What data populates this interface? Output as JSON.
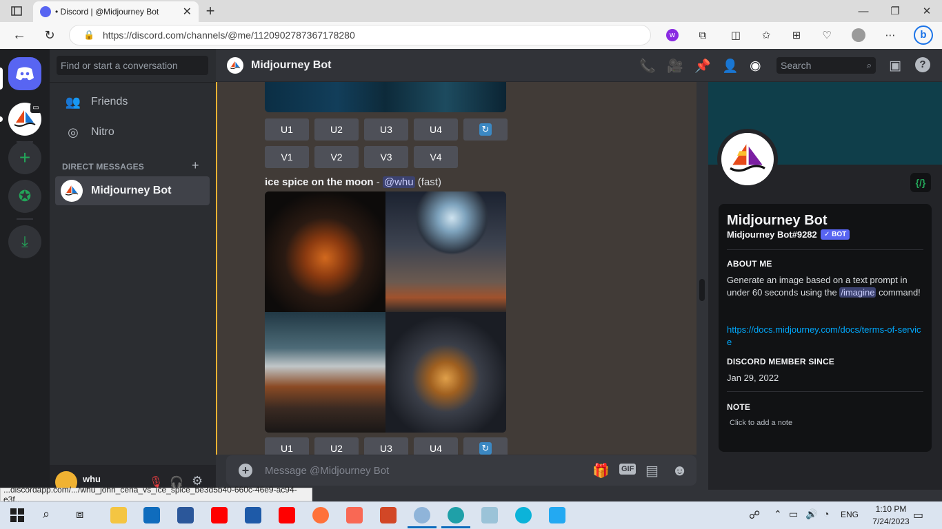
{
  "browser": {
    "tab_title": "• Discord | @Midjourney Bot",
    "url": "https://discord.com/channels/@me/1120902787367178280",
    "status_link": "...discordapp.com/.../whu_john_cena_vs_ice_spice_be3d5b40-660c-46e9-ac94-e3f..."
  },
  "sidebar": {
    "search_placeholder": "Find or start a conversation",
    "friends": "Friends",
    "nitro": "Nitro",
    "dm_header": "DIRECT MESSAGES",
    "dm_item": "Midjourney Bot",
    "user_name": "whu"
  },
  "header": {
    "channel_name": "Midjourney Bot",
    "search_placeholder": "Search"
  },
  "messages": {
    "upscale_buttons": [
      "U1",
      "U2",
      "U3",
      "U4"
    ],
    "variation_buttons": [
      "V1",
      "V2",
      "V3",
      "V4"
    ],
    "prompt": "ice spice on the moon",
    "separator": " - ",
    "mention": "@whu",
    "mode": " (fast)"
  },
  "composer": {
    "placeholder": "Message @Midjourney Bot",
    "gif_label": "GIF"
  },
  "profile": {
    "name": "Midjourney Bot",
    "tag": "Midjourney Bot#9282",
    "bot_badge": "✓ BOT",
    "about_title": "ABOUT ME",
    "about_text_1": "Generate an image based on a text prompt in under 60 seconds using the ",
    "about_cmd": "/imagine",
    "about_text_2": " command!",
    "link": "https://docs.midjourney.com/docs/terms-of-service",
    "member_since_title": "DISCORD MEMBER SINCE",
    "member_since": "Jan 29, 2022",
    "note_title": "NOTE",
    "note_placeholder": "Click to add a note",
    "dev_badge": "{/}"
  },
  "taskbar": {
    "time": "1:10 PM",
    "date": "7/24/2023",
    "lang": "ENG"
  },
  "colors": {
    "blurple": "#5865f2",
    "green": "#23a559",
    "link": "#00a8fc",
    "mention_bg": "#3c4270"
  }
}
